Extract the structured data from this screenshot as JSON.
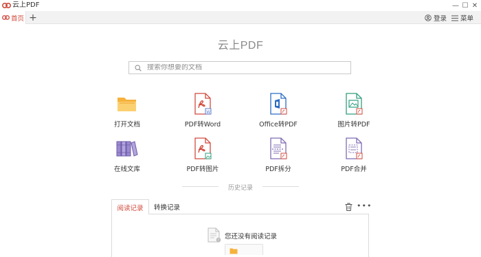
{
  "app": {
    "title": "云上PDF"
  },
  "window_controls": {
    "minimize": "—",
    "maximize": "☐",
    "close": "✕"
  },
  "tabs": {
    "home_label": "首页",
    "add": "+"
  },
  "header": {
    "login_label": "登录",
    "menu_label": "菜单"
  },
  "main": {
    "title": "云上PDF",
    "search_placeholder": "搜索你想要的文档"
  },
  "tools": [
    {
      "label": "打开文档",
      "icon": "folder-icon"
    },
    {
      "label": "PDF转Word",
      "icon": "pdf-to-word-icon"
    },
    {
      "label": "Office转PDF",
      "icon": "office-to-pdf-icon"
    },
    {
      "label": "图片转PDF",
      "icon": "image-to-pdf-icon"
    },
    {
      "label": "在线文库",
      "icon": "library-icon"
    },
    {
      "label": "PDF转图片",
      "icon": "pdf-to-image-icon"
    },
    {
      "label": "PDF拆分",
      "icon": "pdf-split-icon"
    },
    {
      "label": "PDF合并",
      "icon": "pdf-merge-icon"
    }
  ],
  "history": {
    "divider_label": "历史记录",
    "tabs": [
      "阅读记录",
      "转换记录"
    ],
    "active_tab": "阅读记录",
    "empty_text": "您还没有阅读记录"
  },
  "colors": {
    "accent_red": "#d04a3c",
    "folder_orange": "#f0a030",
    "office_blue": "#2b6cc4",
    "image_green": "#2f9e7e",
    "split_purple": "#7f6bb2"
  }
}
